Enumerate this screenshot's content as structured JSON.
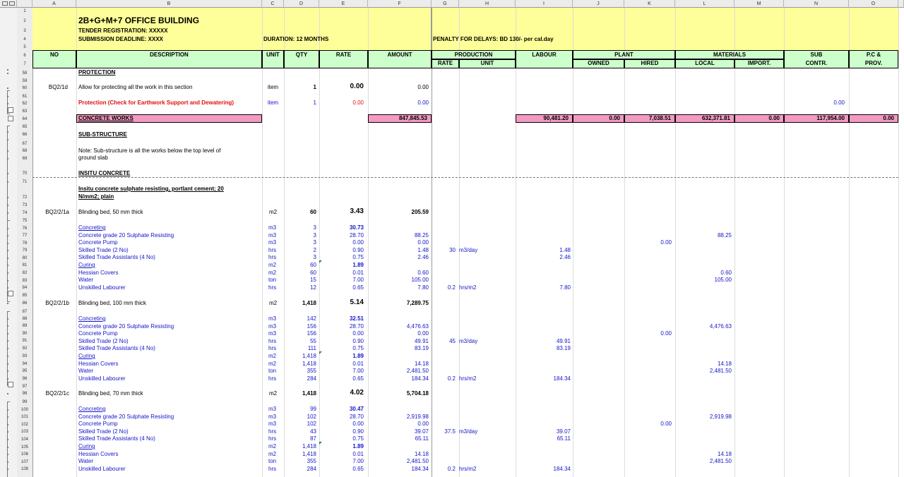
{
  "column_headers": [
    "A",
    "B",
    "C",
    "D",
    "E",
    "F",
    "G",
    "H",
    "I",
    "J",
    "K",
    "L",
    "M",
    "N",
    "O"
  ],
  "header": {
    "title": "2B+G+M+7 OFFICE BUILDING",
    "tender": "TENDER REGISTRATION: XXXXX",
    "deadline": "SUBMISSION DEADLINE:  XXXX",
    "duration": "DURATION: 12 MONTHS",
    "penalty": "PENALTY FOR DELAYS: BD 130/- per cal.day"
  },
  "table_headers": {
    "no": "NO",
    "description": "DESCRIPTION",
    "unit": "UNIT",
    "qty": "QTY",
    "rate": "RATE",
    "amount": "AMOUNT",
    "production": "PRODUCTION",
    "prod_rate": "RATE",
    "prod_unit": "UNIT",
    "labour": "LABOUR",
    "plant": "PLANT",
    "owned": "OWNED",
    "hired": "HIRED",
    "materials": "MATERIALS",
    "local": "LOCAL",
    "import": "IMPORT.",
    "sub": "SUB",
    "contr": "CONTR.",
    "pc": "P.C &",
    "prov": "PROV."
  },
  "row_numbers": [
    "1",
    "2",
    "3",
    "4",
    "5",
    "6",
    "7",
    "58",
    "59",
    "60",
    "61",
    "62",
    "63",
    "64",
    "65",
    "66",
    "67",
    "68",
    "69",
    "70",
    "71",
    "72",
    "73",
    "74",
    "75",
    "76",
    "77",
    "78",
    "79",
    "80",
    "81",
    "82",
    "83",
    "84",
    "85",
    "86",
    "87",
    "88",
    "89",
    "90",
    "91",
    "92",
    "93",
    "94",
    "95",
    "96",
    "97",
    "98",
    "99",
    "100",
    "101",
    "102",
    "103",
    "104",
    "105",
    "106",
    "107",
    "108",
    "109"
  ],
  "protection": {
    "heading": "PROTECTION",
    "item_no": "BQ2/1d",
    "item_desc": "Allow for protecting all the work in this section",
    "item_unit": "item",
    "item_qty": "1",
    "item_rate": "0.00",
    "item_amount": "0.00",
    "check_desc": "Protection (Check for Earthwork Support and Dewatering)",
    "check_unit": "item",
    "check_qty": "1",
    "check_rate": "0.00",
    "check_amount": "0.00",
    "check_sub": "0.00"
  },
  "concrete_works": {
    "label": "CONCRETE WORKS",
    "amount": "847,845.53",
    "labour": "90,481.20",
    "owned": "0.00",
    "hired": "7,038.51",
    "local": "632,371.81",
    "import": "0.00",
    "sub": "117,954.00",
    "pc": "0.00"
  },
  "sub_structure": "SUB-STRUCTURE",
  "note_line1": "Note: Sub-structure is all the works below the top level of",
  "note_line2": "ground slab",
  "insitu": "INSITU CONCRETE",
  "insitu_desc1": "Insitu concrete sulphate resisting, portlant cement; 20",
  "insitu_desc2": "N/mm2; plain",
  "items": [
    {
      "no": "BQ2/2/1a",
      "desc": "Blinding bed, 50 mm thick",
      "unit": "m2",
      "qty": "60",
      "rate": "3.43",
      "amount": "205.59",
      "lines": [
        {
          "desc": "Concreting",
          "unit": "m3",
          "qty": "3",
          "rate": "30.73",
          "amount": "",
          "prod_rate": "",
          "prod_unit": "",
          "labour": "",
          "hired": "",
          "local": ""
        },
        {
          "desc": "Concrete grade 20 Sulphate Resisting",
          "unit": "m3",
          "qty": "3",
          "rate": "28.70",
          "amount": "88.25",
          "prod_rate": "",
          "prod_unit": "",
          "labour": "",
          "hired": "",
          "local": "88.25"
        },
        {
          "desc": "Concrete Pump",
          "unit": "m3",
          "qty": "3",
          "rate": "0.00",
          "amount": "0.00",
          "prod_rate": "",
          "prod_unit": "",
          "labour": "",
          "hired": "0.00",
          "local": ""
        },
        {
          "desc": "Skilled Trade (2 No)",
          "unit": "hrs",
          "qty": "2",
          "rate": "0.90",
          "amount": "1.48",
          "prod_rate": "30",
          "prod_unit": "m3/day",
          "labour": "1.48",
          "hired": "",
          "local": ""
        },
        {
          "desc": "Skilled Trade Assistants (4 No)",
          "unit": "hrs",
          "qty": "3",
          "rate": "0.75",
          "amount": "2.46",
          "prod_rate": "",
          "prod_unit": "",
          "labour": "2.46",
          "hired": "",
          "local": ""
        },
        {
          "desc": "Curing",
          "unit": "m2",
          "qty": "60",
          "rate": "1.89",
          "amount": "",
          "prod_rate": "",
          "prod_unit": "",
          "labour": "",
          "hired": "",
          "local": ""
        },
        {
          "desc": "Hessian Covers",
          "unit": "m2",
          "qty": "60",
          "rate": "0.01",
          "amount": "0.60",
          "prod_rate": "",
          "prod_unit": "",
          "labour": "",
          "hired": "",
          "local": "0.60"
        },
        {
          "desc": "Water",
          "unit": "ton",
          "qty": "15",
          "rate": "7.00",
          "amount": "105.00",
          "prod_rate": "",
          "prod_unit": "",
          "labour": "",
          "hired": "",
          "local": "105.00"
        },
        {
          "desc": "Unskilled Labourer",
          "unit": "hrs",
          "qty": "12",
          "rate": "0.65",
          "amount": "7.80",
          "prod_rate": "0.2",
          "prod_unit": "hrs/m2",
          "labour": "7.80",
          "hired": "",
          "local": ""
        }
      ]
    },
    {
      "no": "BQ2/2/1b",
      "desc": "Blinding bed, 100 mm thick",
      "unit": "m2",
      "qty": "1,418",
      "rate": "5.14",
      "amount": "7,289.75",
      "lines": [
        {
          "desc": "Concreting",
          "unit": "m3",
          "qty": "142",
          "rate": "32.51",
          "amount": "",
          "prod_rate": "",
          "prod_unit": "",
          "labour": "",
          "hired": "",
          "local": ""
        },
        {
          "desc": "Concrete grade 20 Sulphate Resisting",
          "unit": "m3",
          "qty": "156",
          "rate": "28.70",
          "amount": "4,476.63",
          "prod_rate": "",
          "prod_unit": "",
          "labour": "",
          "hired": "",
          "local": "4,476.63"
        },
        {
          "desc": "Concrete Pump",
          "unit": "m3",
          "qty": "156",
          "rate": "0.00",
          "amount": "0.00",
          "prod_rate": "",
          "prod_unit": "",
          "labour": "",
          "hired": "0.00",
          "local": ""
        },
        {
          "desc": "Skilled Trade (2 No)",
          "unit": "hrs",
          "qty": "55",
          "rate": "0.90",
          "amount": "49.91",
          "prod_rate": "45",
          "prod_unit": "m3/day",
          "labour": "49.91",
          "hired": "",
          "local": ""
        },
        {
          "desc": "Skilled Trade Assistants (4 No)",
          "unit": "hrs",
          "qty": "111",
          "rate": "0.75",
          "amount": "83.19",
          "prod_rate": "",
          "prod_unit": "",
          "labour": "83.19",
          "hired": "",
          "local": ""
        },
        {
          "desc": "Curing",
          "unit": "m2",
          "qty": "1,418",
          "rate": "1.89",
          "amount": "",
          "prod_rate": "",
          "prod_unit": "",
          "labour": "",
          "hired": "",
          "local": ""
        },
        {
          "desc": "Hessian Covers",
          "unit": "m2",
          "qty": "1,418",
          "rate": "0.01",
          "amount": "14.18",
          "prod_rate": "",
          "prod_unit": "",
          "labour": "",
          "hired": "",
          "local": "14.18"
        },
        {
          "desc": "Water",
          "unit": "ton",
          "qty": "355",
          "rate": "7.00",
          "amount": "2,481.50",
          "prod_rate": "",
          "prod_unit": "",
          "labour": "",
          "hired": "",
          "local": "2,481.50"
        },
        {
          "desc": "Unskilled Labourer",
          "unit": "hrs",
          "qty": "284",
          "rate": "0.65",
          "amount": "184.34",
          "prod_rate": "0.2",
          "prod_unit": "hrs/m2",
          "labour": "184.34",
          "hired": "",
          "local": ""
        }
      ]
    },
    {
      "no": "BQ2/2/1c",
      "desc": "Blinding bed, 70 mm thick",
      "unit": "m2",
      "qty": "1,418",
      "rate": "4.02",
      "amount": "5,704.18",
      "lines": [
        {
          "desc": "Concreting",
          "unit": "m3",
          "qty": "99",
          "rate": "30.47",
          "amount": "",
          "prod_rate": "",
          "prod_unit": "",
          "labour": "",
          "hired": "",
          "local": ""
        },
        {
          "desc": "Concrete grade 20 Sulphate Resisting",
          "unit": "m3",
          "qty": "102",
          "rate": "28.70",
          "amount": "2,919.98",
          "prod_rate": "",
          "prod_unit": "",
          "labour": "",
          "hired": "",
          "local": "2,919.98"
        },
        {
          "desc": "Concrete Pump",
          "unit": "m3",
          "qty": "102",
          "rate": "0.00",
          "amount": "0.00",
          "prod_rate": "",
          "prod_unit": "",
          "labour": "",
          "hired": "0.00",
          "local": ""
        },
        {
          "desc": "Skilled Trade (2 No)",
          "unit": "hrs",
          "qty": "43",
          "rate": "0.90",
          "amount": "39.07",
          "prod_rate": "37.5",
          "prod_unit": "m3/day",
          "labour": "39.07",
          "hired": "",
          "local": ""
        },
        {
          "desc": "Skilled Trade Assistants (4 No)",
          "unit": "hrs",
          "qty": "87",
          "rate": "0.75",
          "amount": "65.11",
          "prod_rate": "",
          "prod_unit": "",
          "labour": "65.11",
          "hired": "",
          "local": ""
        },
        {
          "desc": "Curing",
          "unit": "m2",
          "qty": "1,418",
          "rate": "1.89",
          "amount": "",
          "prod_rate": "",
          "prod_unit": "",
          "labour": "",
          "hired": "",
          "local": ""
        },
        {
          "desc": "Hessian Covers",
          "unit": "m2",
          "qty": "1,418",
          "rate": "0.01",
          "amount": "14.18",
          "prod_rate": "",
          "prod_unit": "",
          "labour": "",
          "hired": "",
          "local": "14.18"
        },
        {
          "desc": "Water",
          "unit": "ton",
          "qty": "355",
          "rate": "7.00",
          "amount": "2,481.50",
          "prod_rate": "",
          "prod_unit": "",
          "labour": "",
          "hired": "",
          "local": "2,481.50"
        },
        {
          "desc": "Unskilled Labourer",
          "unit": "hrs",
          "qty": "284",
          "rate": "0.65",
          "amount": "184.34",
          "prod_rate": "0.2",
          "prod_unit": "hrs/m2",
          "labour": "184.34",
          "hired": "",
          "local": ""
        }
      ]
    }
  ]
}
